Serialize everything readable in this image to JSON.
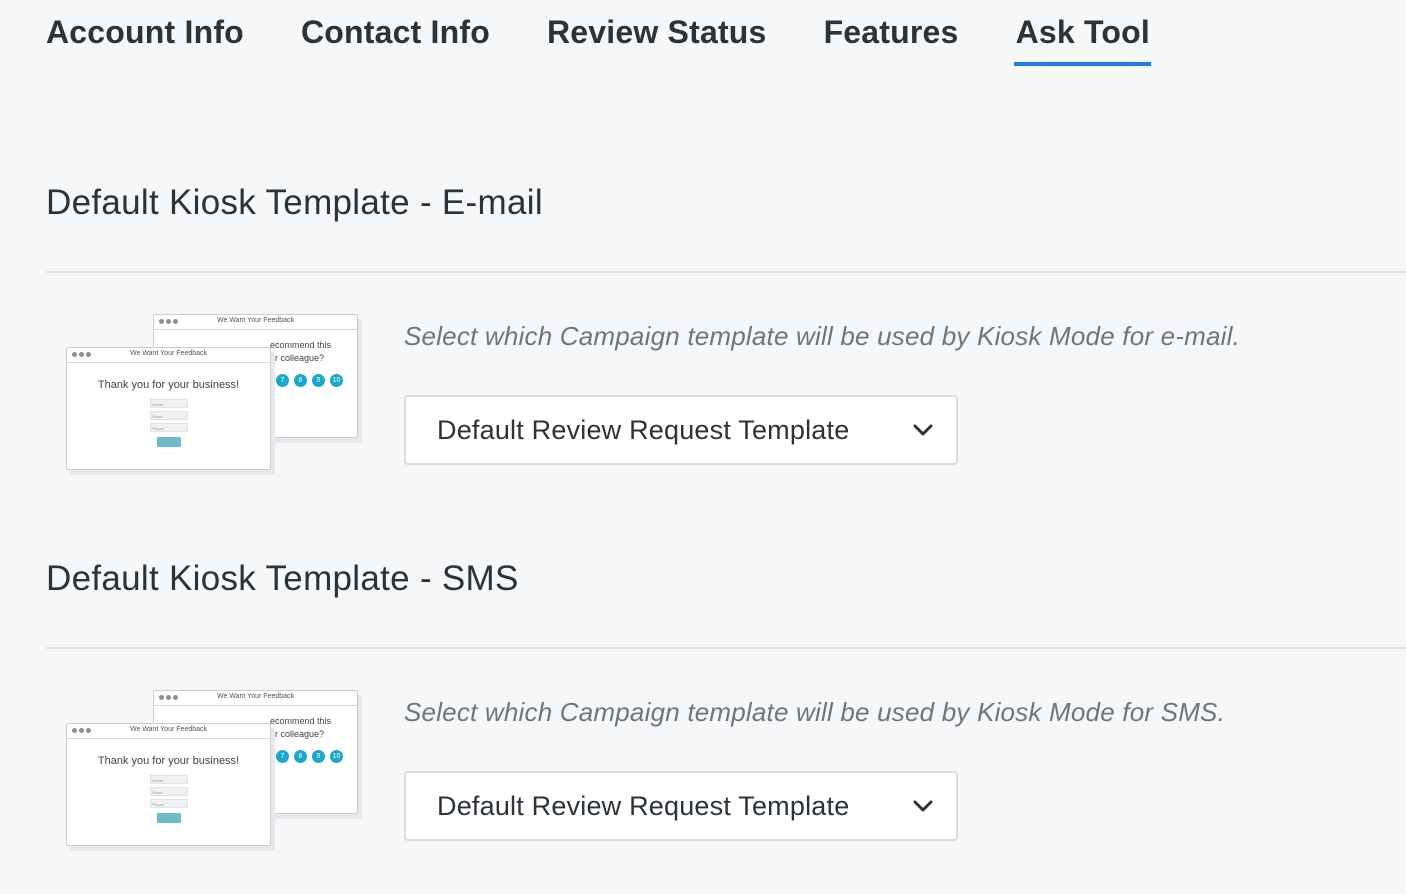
{
  "tabs": [
    {
      "label": "Account Info",
      "active": false
    },
    {
      "label": "Contact Info",
      "active": false
    },
    {
      "label": "Review Status",
      "active": false
    },
    {
      "label": "Features",
      "active": false
    },
    {
      "label": "Ask Tool",
      "active": true
    }
  ],
  "accent_color": "#1e7fe0",
  "sections": [
    {
      "title": "Default Kiosk Template - E-mail",
      "description": "Select which Campaign template will be used by Kiosk Mode for e-mail.",
      "select_value": "Default Review Request Template",
      "select_icon": "chevron-down-icon"
    },
    {
      "title": "Default Kiosk Template - SMS",
      "description": "Select which Campaign template will be used by Kiosk Mode for SMS.",
      "select_value": "Default Review Request Template",
      "select_icon": "chevron-down-icon"
    }
  ],
  "preview": {
    "window_title": "We Want Your Feedback",
    "back_text_line1": "ecommend this",
    "back_text_line2": "or colleague?",
    "rating_numbers": [
      "7",
      "8",
      "9",
      "10"
    ],
    "front_heading": "Thank you for your business!",
    "fields": [
      "Name",
      "Email",
      "Phone"
    ]
  }
}
